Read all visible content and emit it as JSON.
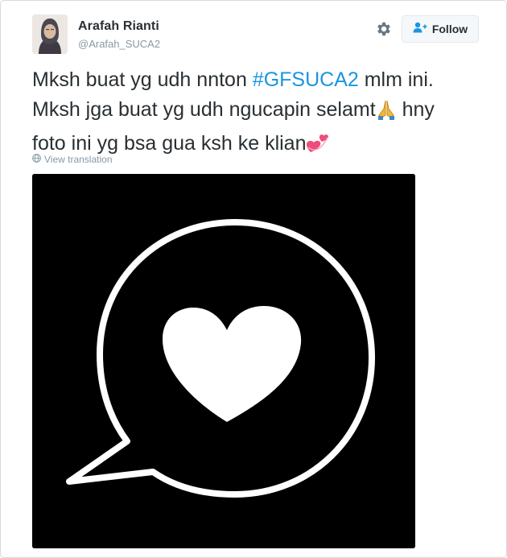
{
  "user": {
    "name": "Arafah Rianti",
    "handle": "@Arafah_SUCA2"
  },
  "actions": {
    "follow_label": "Follow",
    "settings_icon": "gear-icon",
    "follow_icon": "add-user-icon"
  },
  "tweet": {
    "line1_pre": "Mksh buat yg udh nnton ",
    "hashtag": "#GFSUCA2",
    "line1_post": " mlm ini.",
    "line2_pre": "Mksh jga buat yg udh ngucapin selamt",
    "emoji_pray": "folded-hands-icon",
    "line2_post": " hny",
    "line3_pre": "foto ini yg bsa gua ksh ke klian",
    "emoji_hearts": "revolving-hearts-icon"
  },
  "translate_label": "View translation",
  "colors": {
    "hashtag": "#1b95e0",
    "text": "#292f33",
    "muted": "#8899a6",
    "media_bg": "#000000"
  }
}
